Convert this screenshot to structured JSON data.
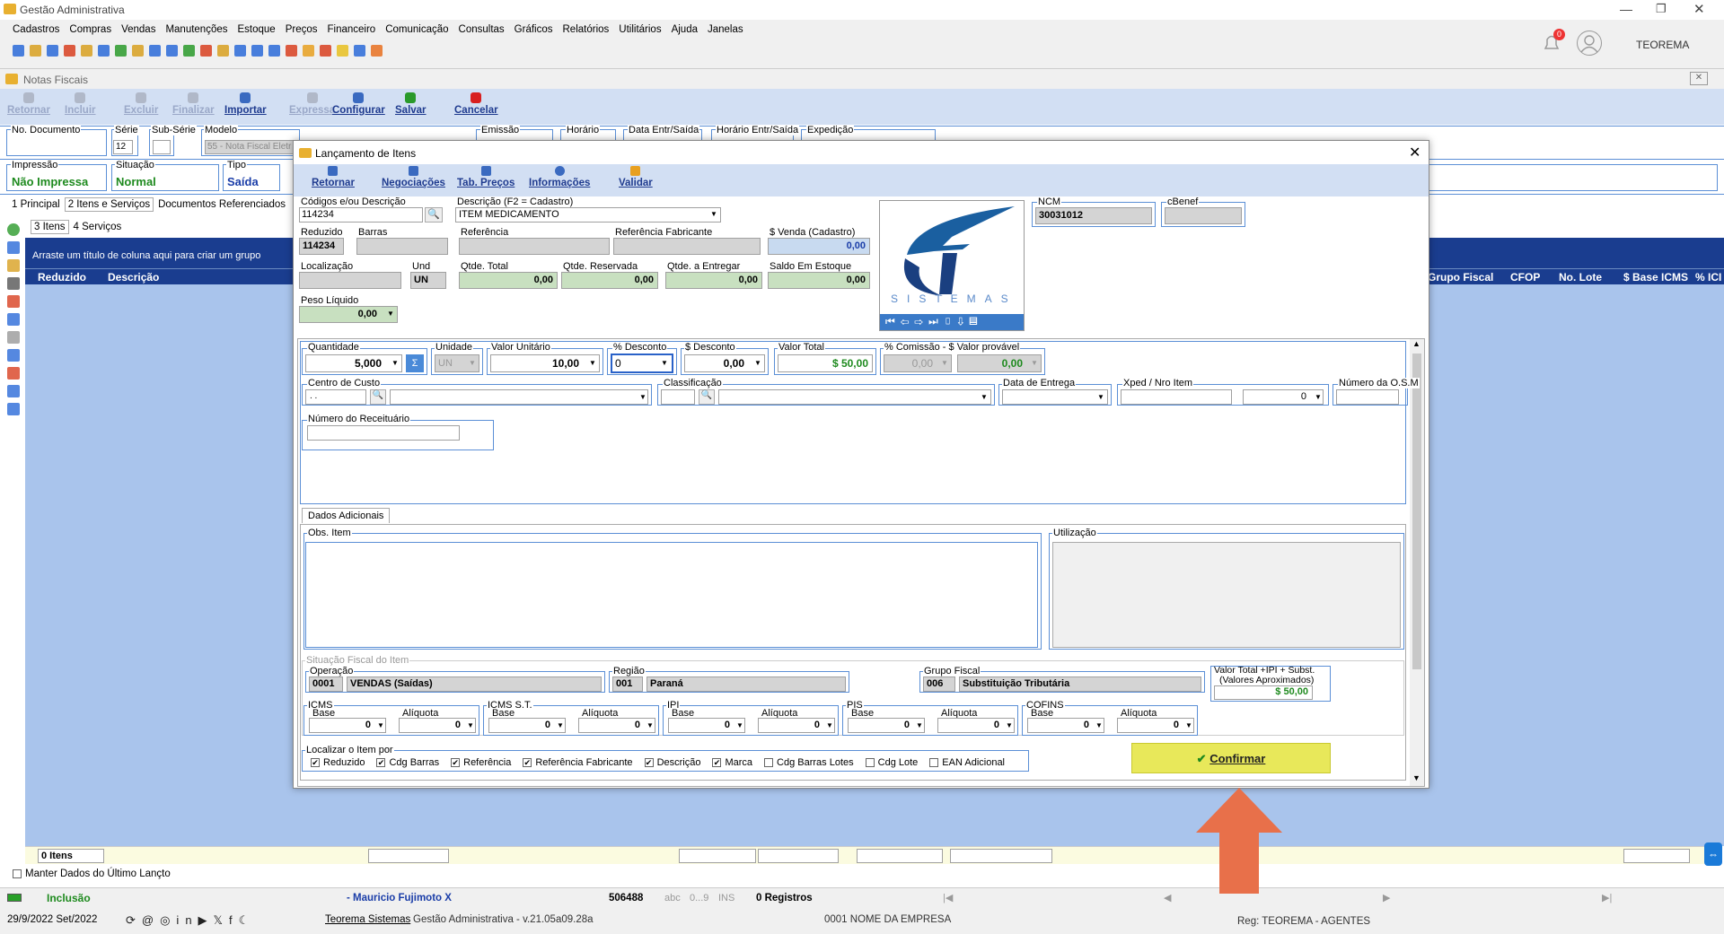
{
  "app": {
    "title": "Gestão Administrativa",
    "user": "TEOREMA",
    "notif_count": "0"
  },
  "menu": [
    "Cadastros",
    "Compras",
    "Vendas",
    "Manutenções",
    "Estoque",
    "Preços",
    "Financeiro",
    "Comunicação",
    "Consultas",
    "Gráficos",
    "Relatórios",
    "Utilitários",
    "Ajuda",
    "Janelas"
  ],
  "nf": {
    "title": "Notas Fiscais",
    "toolbar": [
      "Retornar",
      "Incluir",
      "Excluir",
      "Finalizar",
      "Importar",
      "Expressa",
      "Configurar",
      "Salvar",
      "Cancelar"
    ],
    "row1": {
      "no_doc": "No. Documento",
      "serie": "Série",
      "serie_val": "12",
      "sub_serie": "Sub-Série",
      "modelo": "Modelo",
      "modelo_val": "55 - Nota Fiscal Eletr",
      "emissao": "Emissão",
      "horario": "Horário",
      "data_entr": "Data Entr/Saída",
      "horario_entr": "Horário Entr/Saída",
      "expedicao": "Expedição"
    },
    "row2": {
      "impressao": "Impressão",
      "impressao_val": "Não Impressa",
      "situacao": "Situação",
      "situacao_val": "Normal",
      "tipo": "Tipo",
      "tipo_val": "Saída"
    },
    "tabs": [
      "1 Principal",
      "2 Itens e Serviços",
      "Documentos Referenciados"
    ],
    "subtabs": [
      "3 Itens",
      "4 Serviços"
    ],
    "group_hint": "Arraste um título de coluna aqui para criar um grupo",
    "cols_left": [
      "Reduzido",
      "Descrição"
    ],
    "cols_right": [
      "Grupo Fiscal",
      "CFOP",
      "No. Lote",
      "$ Base ICMS",
      "% ICI"
    ],
    "footer_items": "0 Itens",
    "manter": "Manter Dados do Último Lançto"
  },
  "status": {
    "mode": "Inclusão",
    "user": "- Mauricio Fujimoto X",
    "code": "506488",
    "abc": "abc",
    "range": "0...9",
    "ins": "INS",
    "registros": "0 Registros",
    "date": "29/9/2022 Set/2022",
    "brand": "Teorema Sistemas",
    "version": "Gestão Administrativa - v.21.05a09.28a",
    "empresa": "0001 NOME DA EMPRESA",
    "reg": "Reg: TEOREMA - AGENTES"
  },
  "dlg": {
    "title": "Lançamento de Itens",
    "toolbar": [
      "Retornar",
      "Negociações",
      "Tab. Preços",
      "Informações",
      "Validar"
    ],
    "codigo_lbl": "Códigos e/ou Descrição",
    "codigo_val": "114234",
    "descricao_lbl": "Descrição (F2 = Cadastro)",
    "descricao_val": "ITEM MEDICAMENTO",
    "ncm_lbl": "NCM",
    "ncm_val": "30031012",
    "cbenef_lbl": "cBenef",
    "reduzido_lbl": "Reduzido",
    "reduzido_val": "114234",
    "barras_lbl": "Barras",
    "referencia_lbl": "Referência",
    "ref_fab_lbl": "Referência Fabricante",
    "venda_lbl": "$ Venda (Cadastro)",
    "venda_val": "0,00",
    "localizacao_lbl": "Localização",
    "und_lbl": "Und",
    "und_val": "UN",
    "qt_total_lbl": "Qtde. Total",
    "qt_total_val": "0,00",
    "qt_res_lbl": "Qtde. Reservada",
    "qt_res_val": "0,00",
    "qt_ent_lbl": "Qtde. a Entregar",
    "qt_ent_val": "0,00",
    "saldo_lbl": "Saldo Em Estoque",
    "saldo_val": "0,00",
    "peso_lbl": "Peso Líquido",
    "peso_val": "0,00",
    "logo_text": "SISTEMAS",
    "qtd_lbl": "Quantidade",
    "qtd_val": "5,000",
    "unidade_lbl": "Unidade",
    "unidade_val": "UN",
    "vunit_lbl": "Valor Unitário",
    "vunit_val": "10,00",
    "pdesc_lbl": "% Desconto",
    "pdesc_val": "0",
    "vdesc_lbl": "$ Desconto",
    "vdesc_val": "0,00",
    "vtotal_lbl": "Valor Total",
    "vtotal_val": "$ 50,00",
    "comissao_lbl": "% Comissão - $ Valor provável",
    "comissao_pct": "0,00",
    "comissao_val": "0,00",
    "custo_lbl": "Centro de Custo",
    "custo_val": ". .",
    "classif_lbl": "Classificação",
    "entrega_lbl": "Data de Entrega",
    "xped_lbl": "Xped / Nro Item",
    "xped_item": "0",
    "os_lbl": "Número da O.S.M",
    "receituario_lbl": "Número do Receituário",
    "tab_dados": "Dados Adicionais",
    "obs_lbl": "Obs. Item",
    "utilizacao_lbl": "Utilização",
    "sit_fiscal_lbl": "Situação Fiscal do Item",
    "operacao_lbl": "Operação",
    "op_cod": "0001",
    "op_desc": "VENDAS (Saídas)",
    "regiao_lbl": "Região",
    "reg_cod": "001",
    "reg_desc": "Paraná",
    "grupo_lbl": "Grupo Fiscal",
    "grp_cod": "006",
    "grp_desc": "Substituição Tributária",
    "vt_ipi_lbl": "Valor Total +IPI + Subst.",
    "vt_ipi_sub": "(Valores Aproximados)",
    "vt_ipi_val": "$ 50,00",
    "taxes": [
      {
        "name": "ICMS"
      },
      {
        "name": "ICMS S.T."
      },
      {
        "name": "IPI"
      },
      {
        "name": "PIS"
      },
      {
        "name": "COFINS"
      }
    ],
    "base_lbl": "Base",
    "aliq_lbl": "Alíquota",
    "zero": "0",
    "localizar_lbl": "Localizar o Item por",
    "localizar": [
      {
        "label": "Reduzido",
        "checked": true
      },
      {
        "label": "Cdg Barras",
        "checked": true
      },
      {
        "label": "Referência",
        "checked": true
      },
      {
        "label": "Referência Fabricante",
        "checked": true
      },
      {
        "label": "Descrição",
        "checked": true
      },
      {
        "label": "Marca",
        "checked": true
      },
      {
        "label": "Cdg Barras Lotes",
        "checked": false
      },
      {
        "label": "Cdg Lote",
        "checked": false
      },
      {
        "label": "EAN Adicional",
        "checked": false
      }
    ],
    "confirmar": "Confirmar"
  },
  "colors": {
    "accent": "#1a3d8f",
    "grid_bg": "#a9c4ec",
    "highlight": "#f0f050",
    "arrow": "#e8704a"
  }
}
